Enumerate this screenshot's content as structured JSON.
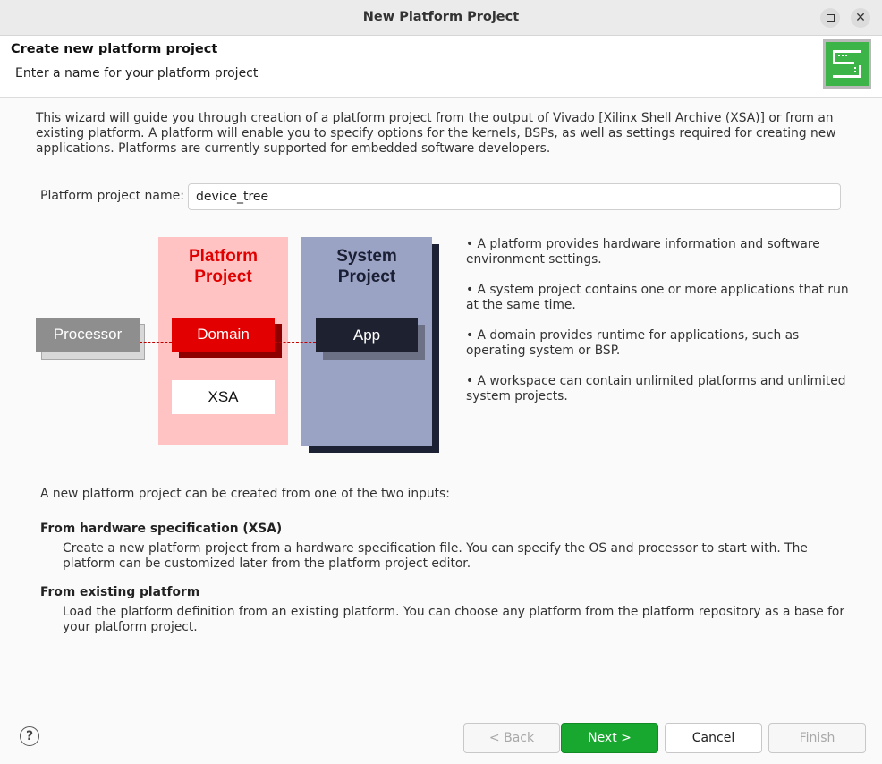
{
  "window": {
    "title": "New Platform Project",
    "maximize_icon": "maximize-icon",
    "close_icon": "close-icon",
    "close_glyph": "✕"
  },
  "header": {
    "title": "Create new platform project",
    "subtitle": "Enter a name for your platform project",
    "logo_icon": "platform-wizard-logo"
  },
  "intro": "This wizard will guide you through creation of a platform project from the output of Vivado [Xilinx Shell Archive (XSA)] or from an existing platform. A platform will enable you to specify options for the kernels, BSPs, as well as settings required for creating new applications. Platforms are currently supported for embedded software developers.",
  "form": {
    "name_label": "Platform project name:",
    "name_value": "device_tree"
  },
  "diagram": {
    "platform_title_line1": "Platform",
    "platform_title_line2": "Project",
    "system_title_line1": "System",
    "system_title_line2": "Project",
    "processor": "Processor",
    "domain": "Domain",
    "app": "App",
    "xsa": "XSA"
  },
  "bullets": [
    "• A platform provides hardware information and software environment settings.",
    "• A system project contains one or more applications that run at the same time.",
    "• A domain provides runtime for applications, such as operating system or BSP.",
    "• A workspace can contain unlimited platforms and unlimited system projects."
  ],
  "options": {
    "intro": "A new platform project can be created from one of the two inputs:",
    "xsa_heading": "From hardware specification (XSA)",
    "xsa_description": "Create a new platform project from a hardware specification file. You can specify the OS and processor to start with. The platform can be customized later from the platform project editor.",
    "existing_heading": "From existing platform",
    "existing_description": "Load the platform definition from an existing platform. You can choose any platform from the platform repository as a base for your platform project."
  },
  "footer": {
    "help_glyph": "?",
    "back_label": "< Back",
    "next_label": "Next >",
    "cancel_label": "Cancel",
    "finish_label": "Finish"
  },
  "colors": {
    "accent_green": "#18a82f",
    "logo_green": "#3db447",
    "platform_red": "#e20000",
    "platform_bg": "#ffc3c3",
    "system_bg": "#9ba3c4"
  }
}
